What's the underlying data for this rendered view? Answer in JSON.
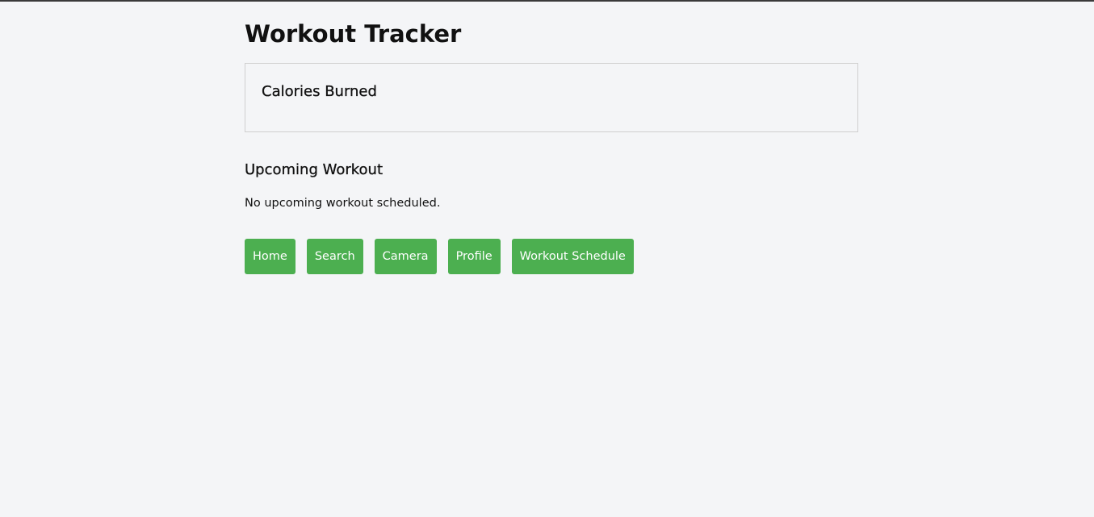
{
  "header": {
    "title": "Workout Tracker"
  },
  "calories_card": {
    "title": "Calories Burned"
  },
  "upcoming": {
    "title": "Upcoming Workout",
    "message": "No upcoming workout scheduled."
  },
  "nav": {
    "home": "Home",
    "search": "Search",
    "camera": "Camera",
    "profile": "Profile",
    "schedule": "Workout Schedule"
  },
  "colors": {
    "button_bg": "#4caf50",
    "page_bg": "#f4f5f7",
    "card_border": "#cfcfcf"
  }
}
